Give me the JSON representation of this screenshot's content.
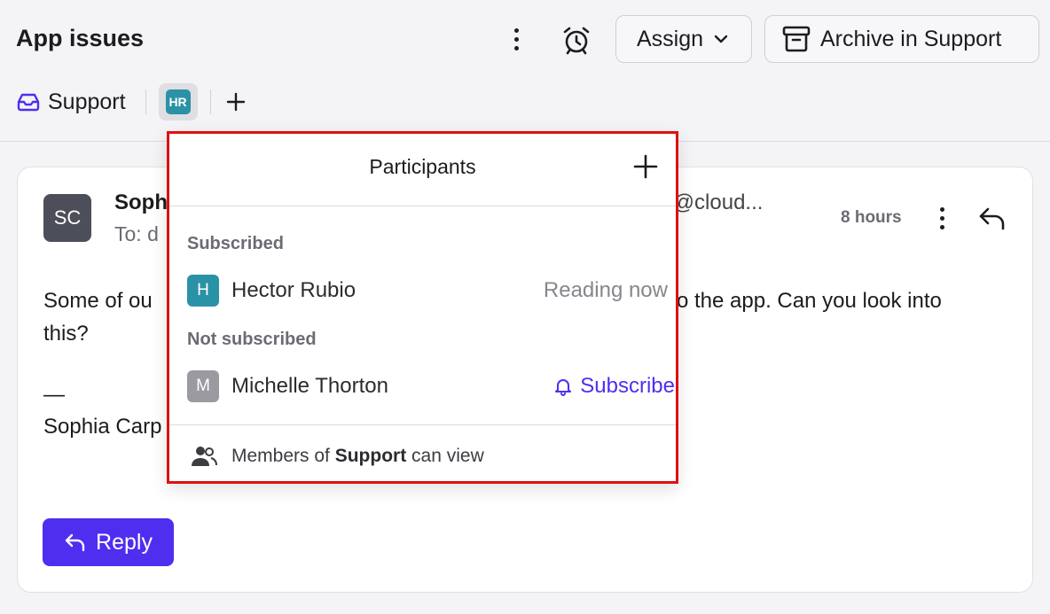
{
  "header": {
    "title": "App issues",
    "assign_label": "Assign",
    "archive_label": "Archive in Support"
  },
  "subnav": {
    "support_label": "Support",
    "assignee_initials": "HR"
  },
  "message": {
    "sender_initials": "SC",
    "sender_name": "Soph",
    "to_label": "To: d",
    "email_fragment": "ia@cloud...",
    "time": "8 hours",
    "body_line1_left": "Some of ou",
    "body_line1_right": "o the app. Can you look into",
    "body_line2": "this?",
    "signature_dash": "—",
    "signature_name": "Sophia Carp",
    "reply_label": "Reply"
  },
  "participants": {
    "title": "Participants",
    "subscribed_label": "Subscribed",
    "subscribed": [
      {
        "initial": "H",
        "name": "Hector Rubio",
        "status": "Reading now",
        "color": "#2a92a6"
      }
    ],
    "not_subscribed_label": "Not subscribed",
    "not_subscribed": [
      {
        "initial": "M",
        "name": "Michelle Thorton",
        "action": "Subscribe",
        "color": "#9a9aa0"
      }
    ],
    "footer_prefix": "Members of",
    "footer_team": "Support",
    "footer_suffix": "can view"
  },
  "colors": {
    "accent": "#4f2ef0",
    "highlight_border": "#e01010"
  }
}
